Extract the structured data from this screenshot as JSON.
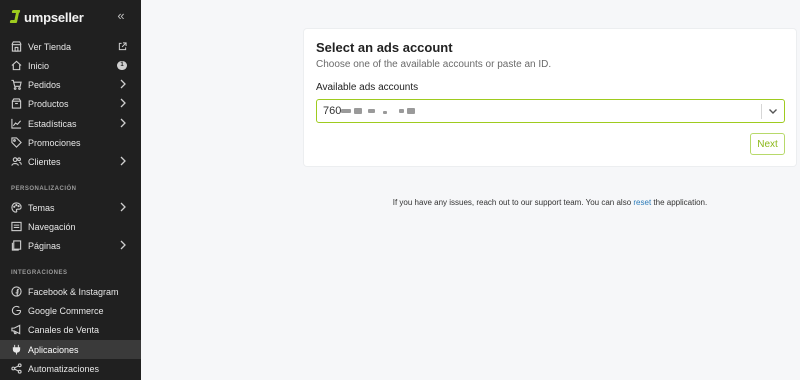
{
  "brand": {
    "name": "umpseller",
    "accent": "#9ecb1f"
  },
  "sidebar": {
    "collapse_icon": "double-chevron-left-icon",
    "items": [
      {
        "label": "Ver Tienda",
        "icon": "store-icon",
        "trail": "external-link-icon"
      },
      {
        "label": "Inicio",
        "icon": "home-icon",
        "badge": "1"
      },
      {
        "label": "Pedidos",
        "icon": "cart-icon",
        "trail": "chevron-right-icon"
      },
      {
        "label": "Productos",
        "icon": "box-icon",
        "trail": "chevron-right-icon"
      },
      {
        "label": "Estadísticas",
        "icon": "chart-line-icon",
        "trail": "chevron-right-icon"
      },
      {
        "label": "Promociones",
        "icon": "tag-icon"
      },
      {
        "label": "Clientes",
        "icon": "users-icon",
        "trail": "chevron-right-icon"
      }
    ],
    "section_personalizacion": "PERSONALIZACIÓN",
    "items_personalizacion": [
      {
        "label": "Temas",
        "icon": "palette-icon",
        "trail": "chevron-right-icon"
      },
      {
        "label": "Navegación",
        "icon": "menu-icon"
      },
      {
        "label": "Páginas",
        "icon": "pages-icon",
        "trail": "chevron-right-icon"
      }
    ],
    "section_integraciones": "INTEGRACIONES",
    "items_integraciones": [
      {
        "label": "Facebook & Instagram",
        "icon": "facebook-icon"
      },
      {
        "label": "Google Commerce",
        "icon": "google-icon"
      },
      {
        "label": "Canales de Venta",
        "icon": "megaphone-icon"
      },
      {
        "label": "Aplicaciones",
        "icon": "plug-icon",
        "active": true
      },
      {
        "label": "Automatizaciones",
        "icon": "share-nodes-icon"
      }
    ]
  },
  "card": {
    "title": "Select an ads account",
    "subtitle": "Choose one of the available accounts or paste an ID.",
    "field_label": "Available ads accounts",
    "select_value": "760",
    "next_label": "Next"
  },
  "help": {
    "prefix": "If you have any issues, reach out to our support team. You can also",
    "link": "reset",
    "suffix": "the application."
  }
}
